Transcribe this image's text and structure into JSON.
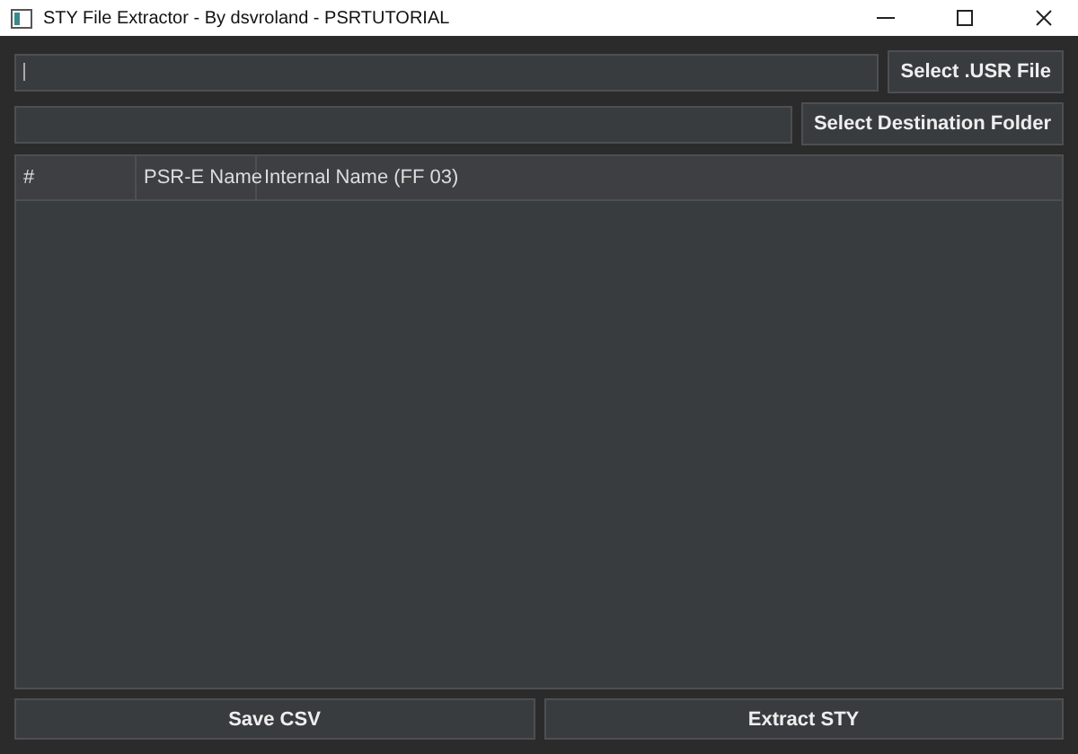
{
  "window": {
    "title": "STY File Extractor - By dsvroland - PSRTUTORIAL"
  },
  "file_row": {
    "button": "Select .USR File"
  },
  "folder_row": {
    "button": "Select Destination Folder"
  },
  "table": {
    "columns": [
      "#",
      "PSR-E Name",
      "Internal Name (FF 03)"
    ]
  },
  "buttons": [
    "Save CSV",
    "Extract STY"
  ]
}
